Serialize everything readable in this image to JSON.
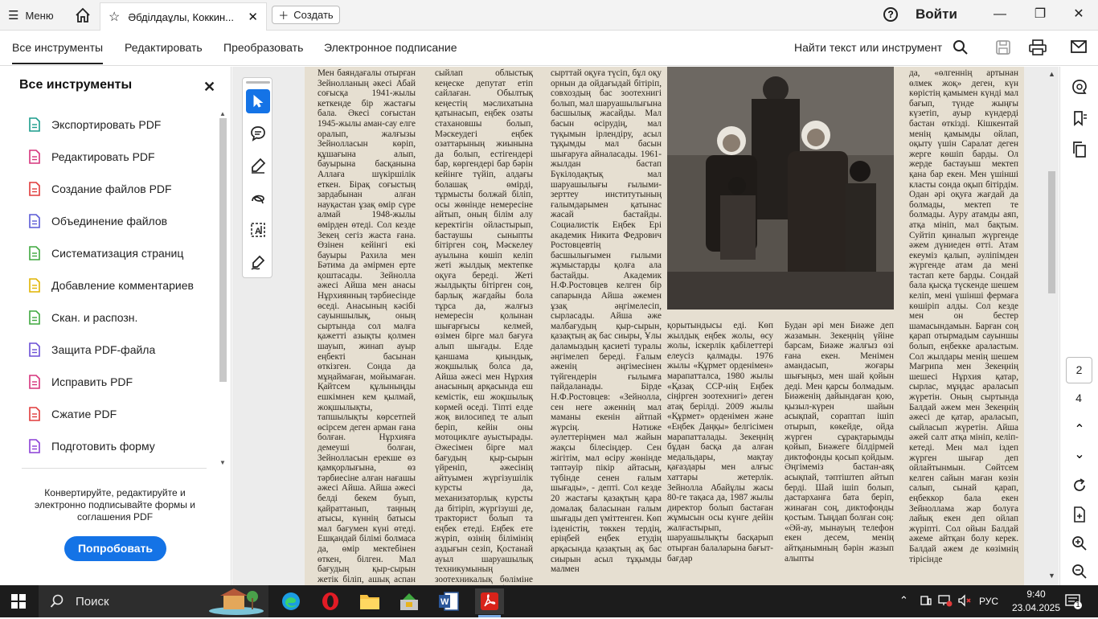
{
  "titlebar": {
    "menu_label": "Меню",
    "tab_title": "Әбділдаұлы, Коккин...",
    "create_label": "Создать",
    "login_label": "Войти"
  },
  "toolbar": {
    "tabs": [
      "Все инструменты",
      "Редактировать",
      "Преобразовать",
      "Электронное подписание"
    ],
    "find_label": "Найти текст или инструмент"
  },
  "left_panel": {
    "title": "Все инструменты",
    "items": [
      {
        "label": "Экспортировать PDF",
        "icon": "export-pdf-icon",
        "color": "#1a9c8c"
      },
      {
        "label": "Редактировать PDF",
        "icon": "edit-pdf-icon",
        "color": "#d6337c"
      },
      {
        "label": "Создание файлов PDF",
        "icon": "create-pdf-icon",
        "color": "#e03a3a"
      },
      {
        "label": "Объединение файлов",
        "icon": "combine-files-icon",
        "color": "#5a5ad6"
      },
      {
        "label": "Систематизация страниц",
        "icon": "organize-pages-icon",
        "color": "#3fa83f"
      },
      {
        "label": "Добавление комментариев",
        "icon": "comment-icon",
        "color": "#e0b400"
      },
      {
        "label": "Скан. и распозн.",
        "icon": "scan-ocr-icon",
        "color": "#3fa83f"
      },
      {
        "label": "Защита PDF-файла",
        "icon": "protect-pdf-icon",
        "color": "#6b4fd6"
      },
      {
        "label": "Исправить PDF",
        "icon": "redact-pdf-icon",
        "color": "#d6337c"
      },
      {
        "label": "Сжатие PDF",
        "icon": "compress-pdf-icon",
        "color": "#e03a3a"
      },
      {
        "label": "Подготовить форму",
        "icon": "prepare-form-icon",
        "color": "#8a3fd6"
      }
    ],
    "promo_text": "Конвертируйте, редактируйте и электронно подписывайте формы и соглашения PDF",
    "try_label": "Попробовать"
  },
  "document": {
    "columns": [
      "Мен баяндағалы отырған Зейнолланың әкесі Абай соғысқа 1941-жылы кеткенде бір жастағы бала. Әкесі соғыстан 1945-жылы аман-сау елге оралып, жалғызы Зейнолласын көріп, құшағына алып, бауырына басқанына Аллаға шүкіршілік еткен. Бірақ соғыстың зардабынан алған науқастан ұзақ өмір сүре алмай 1948-жылы өмірден өтеді. Сол кезде Зекең сегіз жаста ғана. Өзінен кейінгі екі бауыры Рахила мен Бәтима да әмірмен ерте қоштасады. Зейнолла әжесі Айша мен анасы Нұрхиянның тәрбиесінде өседі. Анасының кәсібі сауыншылық, оның сыртында сол малға қажетті азықты қолмен шауып, жинап ауыр еңбекті басынан өткізген. Сонда да мұңаймаған, мойымаған. Қайтсем құлыныңды ешкімнен кем қылмай, жоқшылықты, тапшылықты көрсетпей өсірсем деген арман ғана болған. Нұрхияға демеуші болған, Зейнолласын ерекше өз қамқорлығына, өз тәрбиесіне алған нағашы әжесі Айша. Айша әжесі белді бекем буып, қайраттанып, таңның атысы, күннің батысы мал бағумен күні өтеді. Ешқандай білімі болмаса да, өмір мектебінен өткен, білген. Мал бағудың қыр-сырын жетік біліп, ашық аспан астында",
      "сыйлап облыстық кеңеске депутат етіп сайлаған. Обылтық кеңестің мәслихатына қатынасып, еңбек озаты стахановшы болып, Мәскеудегі еңбек озаттарының жиынына да болып, естігендері бар, көргендері бар бәрін кейінге түйіп, алдағы болашақ өмірді, тұрмысты болжай біліп, осы жөнінде немересіне айтып, оның білім алу керектігін ойластырып, бастаушы сыныпты бітірген соң, Мәскелеу ауылына көшіп келіп жеті жылдық мектепке оқуға береді. Жеті жылдықты бітірген соң, барлық жағдайы бола тұрса да, жалғыз немересін қолынан шығарғысы келмей, өзімен бірге мал бағуға алып шығады. Елде қаншама қиындық, жоқшылық болса да, Айша әжесі мен Нұрхия анасының арқасында еш кемістік, еш жоқшылық көрмей өседі. Тіпті елде жоқ вилосипед те алып беріп, кейін оны мотоциклге ауыстырады. Әжесімен бірге мал бағудың қыр-сырын үйреніп, әжесінің айтуымен жүргізушілік курсты да, механизаторлық курсты да бітіріп, жүргізуші де, тракторист болып та еңбек етеді. Еңбек ете жүріп, өзінің білімінің аздығын сезіп, Қостанай ауыл шаруашылық техникумының зоотехникалық бөліміне сырттай түсіп, бұл оқу орнын ойдағыдай",
      "сырттай оқуға түсіп, бұл оқу орнын да ойдағыдай бітіріп, совхоздың бас зоотехнигі болып, мал шаруашылығына басшылық жасайды. Мал басын өсірудің, мал түқымын ірлендіру, асыл тұқымды мал басын шығаруға айналасады. 1961-жылдан бастап Бүкілодақтық мал шаруашылығы ғылыми-зерттеу институтының ғалымдарымен қатынас жасай бастайды. Социалистік Еңбек Ері академик Никита Федрович Ростовцевтің басшылығымен ғылыми жұмыстарды қолға ала бастайды. Академик Н.Ф.Ростовцев келген бір сапарында Айша әжемен ұзақ әңгімелесіп, сырласады. Айша әже малбағудың қыр-сырын, қазақтың ақ бас сиыры, Ұлы даламыздың қасиеті туралы әңгімелеп береді. Ғалым әженің әңгімесінен түйгендерін ғылымға пайдаланады. Бірде Н.Ф.Ростовцев: «Зейнолла, сен неге әженнің мал маманы екенін айтпай жүрсің. Нәтиже әулеттеріңмен мал жайын жақсы білесіңдер. Сен жігітім, мал өсіру жөнінде тәптәуір пікір айтасың, түбінде сенен ғалым шығады», - депті. Сол кезде 20 жастағы қазақтың қара домалақ баласынан ғалым шығады деп үміттенген. Көп ізденістің, төккен тердің, еріңбей еңбек етудің арқасында қазақтың ақ бас сиырын асыл тұқымды малмен",
      "қорытындысы еді. Көп жылдық еңбек жолы, өсу жолы, іскерлік қабілеттері елеусіз қалмады. 1976 жылы «Құрмет орденімен» марапатталса, 1980 жылы «Қазақ ССР-нің Еңбек сіңірген зоотехнигі» деген атақ берілді. 2009 жылы «Құрмет» орденімен және «Еңбек Даңқы» белгісімен марапатталады. Зекеңнің бұдан басқа да алған медальдары, мақтау қағаздары мен алғыс хаттары жетерлік. Зейнолла Абайұлы жасы 80-ге тақаса да, 1987 жылы директор болып бастаған жұмысын осы күнге дейін жалғастырып, шаруашылықты басқарып отырған балаларына бағыт-бағдар",
      "Будан әрі мен Биәже деп жазамын. Зекеңнің үйіне барсам, Биәже жалғыз өзі ғана екен. Менімен амандасып, жоғары шығыңыз, мен шай қойын деді. Мен қарсы болмадым. Биәженің дайындаған қою, қызыл-күрен шайын асықпай, сораптап ішіп отырып, көкейде, ойда жүрген сұрақтарымды қойып, Биәжеге білдірмей диктофонды қосып қойдым. Әңгімеміз бастан-аяқ асықпай, тәптіштеп айтып берді. Шай ішіп болып, дастарханға бата беріп, жинаған соң, диктофонды қостым. Тыңдап болған соң: «Әй-ау, мынауың телефон екен десем, менің айтқанымның бәрін жазып алыпты",
      "да, «өлгеннің артынан өлмек жоқ» деген, күн көрістің қамымен күнді мал бағып, түнде жыңғы күзетіп, ауыр күндерді бастан өткізді. Кішкентай менің қамымды ойлап, оқыту үшін Саралат деген жерге көшіп барды. Ол жерде бастауыш мектеп қана бар екен. Мен үшінші класты сонда оқып бітірдім. Одан әрі оқуға жағдай да болмады, мектеп те болмады. Ауру атамды аяп, атқа мініп, мал бақтым. Суйтіп қиналып жүргенде әжем дүниеден өтті. Атам екеуміз қалып, әуліпімден жүргенде атам да мені тастап кете барды. Сондай бала қысқа түскенде шешем келіп, мені үшінші фермаға көшіріп алды. Сол кезде мен он бестер шамасындамын. Барған соң қарап отырмадым сауыншы болып, еңбекке араластым. Сол жылдары менің шешем Мағрипа мен Зекеңнің шешесі Нұрхия қатар, сырлас, мұңдас араласып жүретін. Оның сыртында Балдай әжем мен Зекеңнің әжесі де қатар, араласып, сыйласып жүретін. Айша әжей салт атқа мініп, келіп-кетеді. Мен мал іздеп жүрген шығар деп ойлайтынмын. Сөйтсем келген сайын маған көзін салып, сынай қарап, еңбеккор бала екен Зейноллама жар болуға лайық екен деп ойлап жүріпті. Сол ойын Балдай әжеме айтқан болу керек. Балдай әжем де көзімнің тірісінде"
    ]
  },
  "right_rail": {
    "current_page": "2",
    "total_pages": "4"
  },
  "taskbar": {
    "search_label": "Поиск",
    "lang": "РУС",
    "time": "9:40",
    "date": "23.04.2025",
    "notif_count": "1"
  }
}
